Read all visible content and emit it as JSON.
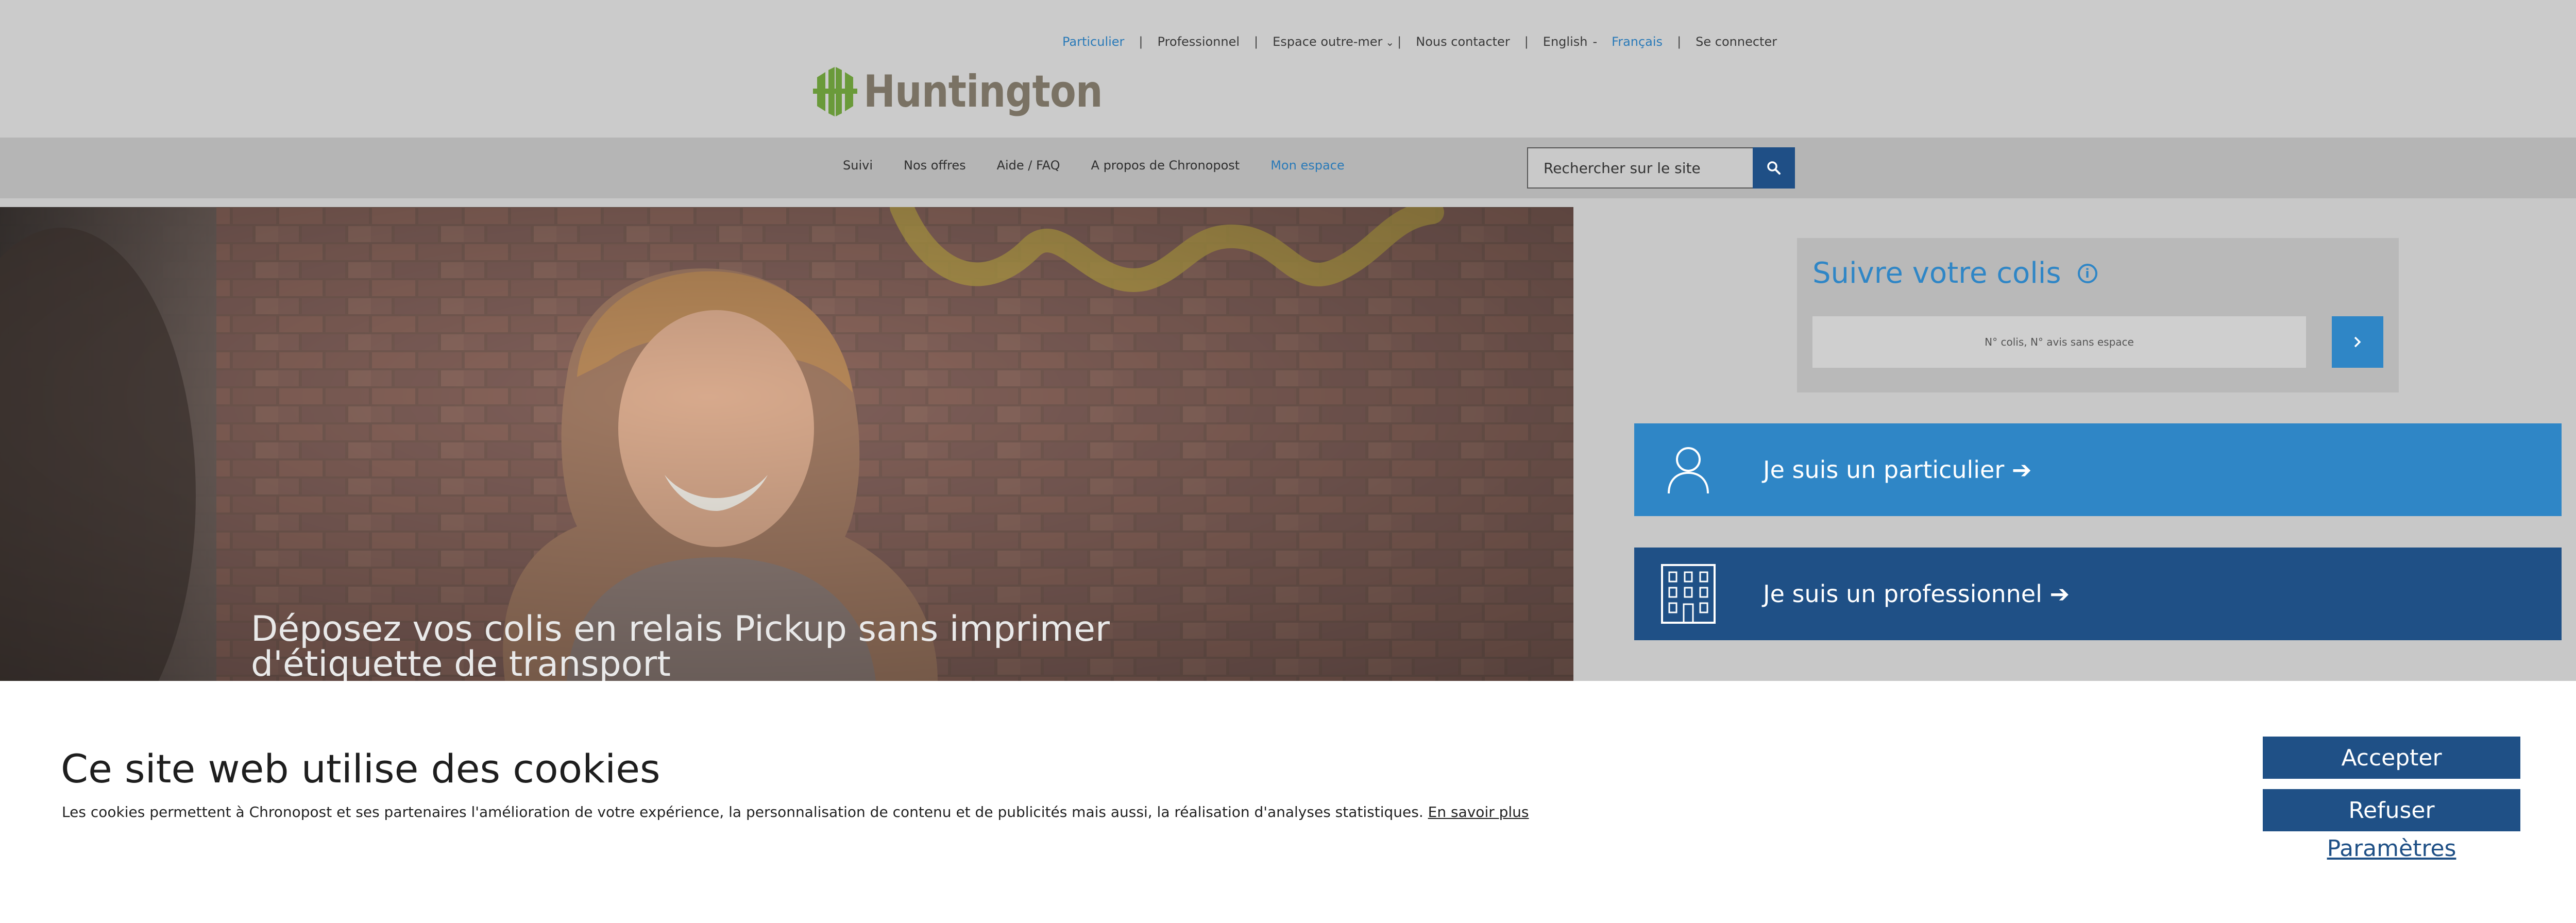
{
  "topbar": {
    "links": {
      "particulier": "Particulier",
      "professionnel": "Professionnel",
      "outremer": "Espace outre-mer",
      "contact": "Nous contacter",
      "english": "English",
      "francais": "Français",
      "login": "Se connecter"
    },
    "separator": "|"
  },
  "logo": {
    "wordmark": "Huntington",
    "color": "#6a9a3a"
  },
  "nav": {
    "items": [
      "Suivi",
      "Nos offres",
      "Aide / FAQ",
      "A propos de Chronopost",
      "Mon espace"
    ],
    "search_placeholder": "Rechercher sur le site"
  },
  "hero": {
    "headline": "Déposez vos colis en relais Pickup sans imprimer d'étiquette de transport"
  },
  "tracking": {
    "title": "Suivre votre colis",
    "info_glyph": "i",
    "input_placeholder": "N° colis, N° avis sans espace"
  },
  "cta": {
    "particulier": "Je suis un particulier ➔",
    "professionnel": "Je suis un professionnel ➔"
  },
  "cookie": {
    "title": "Ce site web utilise des cookies",
    "text": "Les cookies permettent à Chronopost et ses partenaires l'amélioration de votre expérience, la personnalisation de contenu et de publicités mais aussi, la réalisation d'analyses statistiques.",
    "learn_more": "En savoir plus",
    "accept": "Accepter",
    "refuse": "Refuser",
    "settings": "Paramètres"
  },
  "colors": {
    "accent_blue": "#2f86c6",
    "dark_blue": "#1f5086",
    "link_blue": "#2a7ab8"
  },
  "icons": [
    "chevron-down-icon",
    "search-icon",
    "info-icon",
    "chevron-right-icon",
    "person-icon",
    "building-icon",
    "logo-icon"
  ]
}
